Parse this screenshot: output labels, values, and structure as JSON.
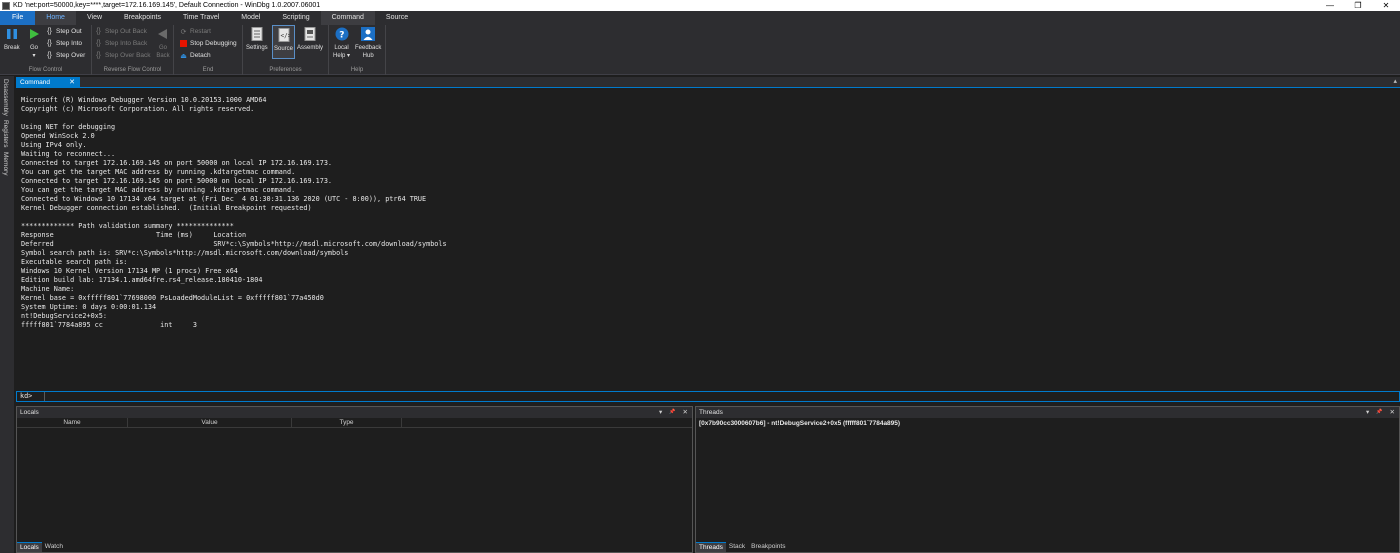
{
  "window": {
    "title": "KD 'net:port=50000,key=****,target=172.16.169.145', Default Connection  -  WinDbg 1.0.2007.06001",
    "controls": [
      "—",
      "❐",
      "✕"
    ]
  },
  "ribbon_tabs": [
    "File",
    "Home",
    "View",
    "Breakpoints",
    "Time Travel",
    "Model",
    "Scripting",
    "Command",
    "Source"
  ],
  "ribbon": {
    "flow_control": {
      "label": "Flow Control",
      "break": "Break",
      "go": "Go",
      "step_out": "Step Out",
      "step_into": "Step Into",
      "step_over": "Step Over"
    },
    "reverse_flow_control": {
      "label": "Reverse Flow Control",
      "step_out_back": "Step Out Back",
      "step_into_back": "Step Into Back",
      "step_over_back": "Step Over Back",
      "go_back_1": "Go",
      "go_back_2": "Back"
    },
    "end": {
      "label": "End",
      "restart": "Restart",
      "stop_debugging": "Stop Debugging",
      "detach": "Detach"
    },
    "preferences": {
      "label": "Preferences",
      "settings": "Settings",
      "source": "Source",
      "assembly": "Assembly"
    },
    "help": {
      "label": "Help",
      "local_help_1": "Local",
      "local_help_2": "Help ▾",
      "feedback_hub_1": "Feedback",
      "feedback_hub_2": "Hub"
    }
  },
  "side_tabs": [
    "Disassembly",
    "Registers",
    "Memory"
  ],
  "command_window": {
    "tab_label": "Command",
    "close_glyph": "✕",
    "scroll_glyph": "▴",
    "output": "Microsoft (R) Windows Debugger Version 10.0.20153.1000 AMD64\nCopyright (c) Microsoft Corporation. All rights reserved.\n\nUsing NET for debugging\nOpened WinSock 2.0\nUsing IPv4 only.\nWaiting to reconnect...\nConnected to target 172.16.169.145 on port 50000 on local IP 172.16.169.173.\nYou can get the target MAC address by running .kdtargetmac command.\nConnected to target 172.16.169.145 on port 50000 on local IP 172.16.169.173.\nYou can get the target MAC address by running .kdtargetmac command.\nConnected to Windows 10 17134 x64 target at (Fri Dec  4 01:30:31.136 2020 (UTC - 8:00)), ptr64 TRUE\nKernel Debugger connection established.  (Initial Breakpoint requested)\n\n************* Path validation summary **************\nResponse                         Time (ms)     Location\nDeferred                                       SRV*c:\\Symbols*http://msdl.microsoft.com/download/symbols\nSymbol search path is: SRV*c:\\Symbols*http://msdl.microsoft.com/download/symbols\nExecutable search path is:\nWindows 10 Kernel Version 17134 MP (1 procs) Free x64\nEdition build lab: 17134.1.amd64fre.rs4_release.180410-1804\nMachine Name:\nKernel base = 0xfffff801`77698000 PsLoadedModuleList = 0xfffff801`77a450d0\nSystem Uptime: 0 days 0:00:01.134\nnt!DebugService2+0x5:\nfffff801`7784a895 cc              int     3",
    "prompt": "kd>",
    "input_value": ""
  },
  "locals_pane": {
    "title": "Locals",
    "controls": [
      "▾",
      "📌",
      "✕"
    ],
    "columns": [
      "Name",
      "Value",
      "Type"
    ],
    "bottom_tabs": [
      "Locals",
      "Watch"
    ]
  },
  "threads_pane": {
    "title": "Threads",
    "controls": [
      "▾",
      "📌",
      "✕"
    ],
    "rows": [
      "[0x7b90cc3000607b6] - nt!DebugService2+0x5 (fffff801`7784a895)"
    ],
    "bottom_tabs": [
      "Threads",
      "Stack",
      "Breakpoints"
    ]
  },
  "colors": {
    "accent": "#007acc",
    "file_tab": "#1c6fc4",
    "background": "#1e1e1e",
    "ribbon": "#2d2d30",
    "stop_red": "#e51400",
    "go_green": "#3fbf3f"
  }
}
